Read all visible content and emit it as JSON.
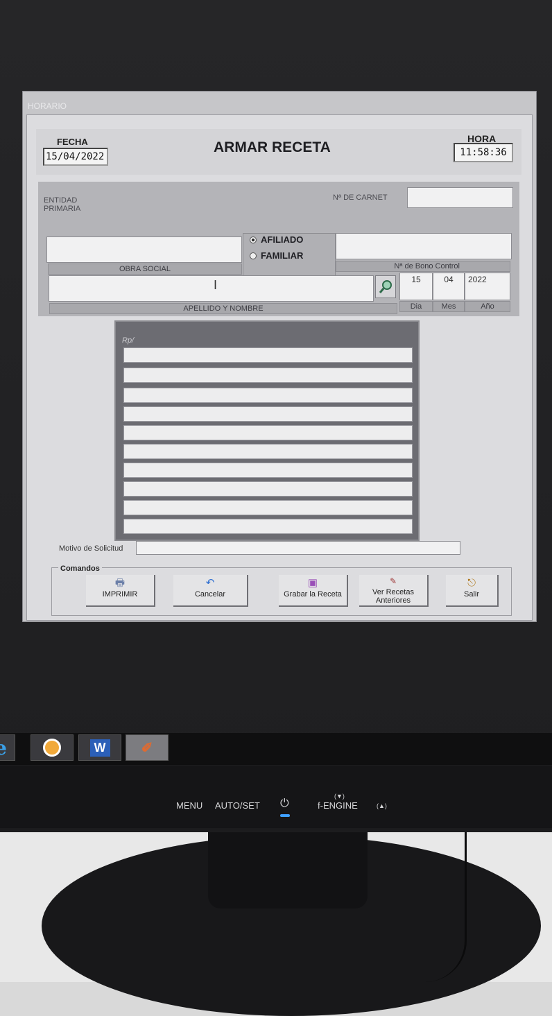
{
  "window": {
    "title": "HORARIO"
  },
  "header": {
    "fecha_label": "FECHA",
    "fecha_value": "15/04/2022",
    "title": "ARMAR RECETA",
    "hora_label": "HORA",
    "hora_value": "11:58:36"
  },
  "patient": {
    "entidad_label": "ENTIDAD PRIMARIA",
    "carnet_label": "Nª DE CARNET",
    "carnet_value": "",
    "obra_social_label": "OBRA SOCIAL",
    "obra_social_value": "",
    "radio_afiliado": "AFILIADO",
    "radio_familiar": "FAMILIAR",
    "selected_radio": "AFILIADO",
    "bono_label": "Nª de Bono Control",
    "apellido_label": "APELLIDO Y NOMBRE",
    "apellido_value": "",
    "date": {
      "dia": "15",
      "mes": "04",
      "anio": "2022"
    },
    "date_labels": {
      "dia": "Dia",
      "mes": "Mes",
      "anio": "Año"
    }
  },
  "rp": {
    "label": "Rp/",
    "lines": [
      "",
      "",
      "",
      "",
      "",
      "",
      "",
      "",
      "",
      ""
    ]
  },
  "motivo": {
    "label": "Motivo de Solicitud",
    "value": ""
  },
  "commands": {
    "title": "Comandos",
    "buttons": [
      {
        "label": "IMPRIMIR",
        "icon": "printer-icon"
      },
      {
        "label": "Cancelar",
        "icon": "undo-icon"
      },
      {
        "label": "Grabar la Receta",
        "icon": "save-disk-icon"
      },
      {
        "label": "Ver Recetas Anteriores",
        "icon": "recipes-icon"
      },
      {
        "label": "Salir",
        "icon": "exit-door-icon"
      }
    ]
  },
  "taskbar": {
    "items": [
      "ie-icon",
      "app-icon",
      "word-icon",
      "pencil-app-icon"
    ]
  },
  "monitor": {
    "menu": "MENU",
    "autoset": "AUTO/SET",
    "fengine": "f-ENGINE",
    "up": "(▲)",
    "down": "(▼)"
  }
}
